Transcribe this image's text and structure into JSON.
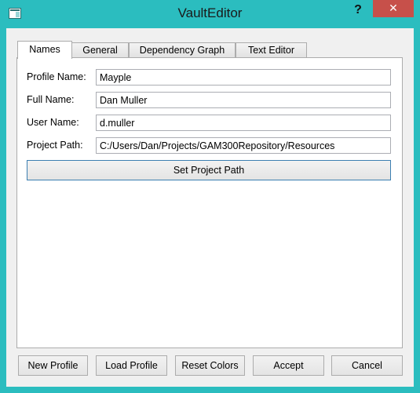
{
  "window": {
    "title": "VaultEditor",
    "help_label": "?",
    "close_label": "✕",
    "colors": {
      "frame": "#2bbdbf",
      "close": "#c7504a"
    }
  },
  "tabs": [
    {
      "label": "Names",
      "active": true
    },
    {
      "label": "General",
      "active": false
    },
    {
      "label": "Dependency Graph",
      "active": false
    },
    {
      "label": "Text Editor",
      "active": false
    }
  ],
  "names": {
    "profile_name": {
      "label": "Profile Name:",
      "value": "Mayple"
    },
    "full_name": {
      "label": "Full Name:",
      "value": "Dan Muller"
    },
    "user_name": {
      "label": "User Name:",
      "value": "d.muller"
    },
    "project_path": {
      "label": "Project Path:",
      "value": "C:/Users/Dan/Projects/GAM300Repository/Resources"
    },
    "set_path_button": "Set Project Path"
  },
  "footer": {
    "new_profile": "New Profile",
    "load_profile": "Load Profile",
    "reset_colors": "Reset Colors",
    "accept": "Accept",
    "cancel": "Cancel"
  }
}
